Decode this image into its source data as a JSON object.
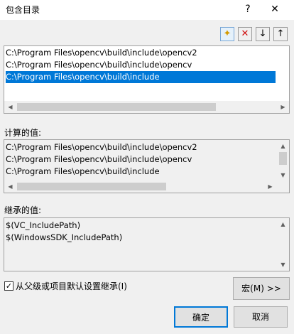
{
  "window": {
    "title": "包含目录",
    "help_label": "?",
    "close_label": "✕"
  },
  "toolbar": {
    "new_line_icon": "✦",
    "delete_icon": "✕",
    "down_icon": "↓",
    "up_icon": "↑"
  },
  "include_list": {
    "items": [
      "C:\\Program Files\\opencv\\build\\include\\opencv2",
      "C:\\Program Files\\opencv\\build\\include\\opencv",
      "C:\\Program Files\\opencv\\build\\include"
    ],
    "selected_index": 2
  },
  "evaluated": {
    "label": "计算的值:",
    "items": [
      "C:\\Program Files\\opencv\\build\\include\\opencv2",
      "C:\\Program Files\\opencv\\build\\include\\opencv",
      "C:\\Program Files\\opencv\\build\\include"
    ]
  },
  "inherited": {
    "label": "继承的值:",
    "items": [
      "$(VC_IncludePath)",
      "$(WindowsSDK_IncludePath)"
    ]
  },
  "options": {
    "inherit_label": "从父级或项目默认设置继承(I)",
    "inherit_checked": true,
    "check_mark": "✓"
  },
  "buttons": {
    "macros_label": "宏(M) >>",
    "ok_label": "确定",
    "cancel_label": "取消"
  },
  "scroll_arrows": {
    "left": "◀",
    "right": "▶",
    "up": "▲",
    "down": "▼"
  }
}
